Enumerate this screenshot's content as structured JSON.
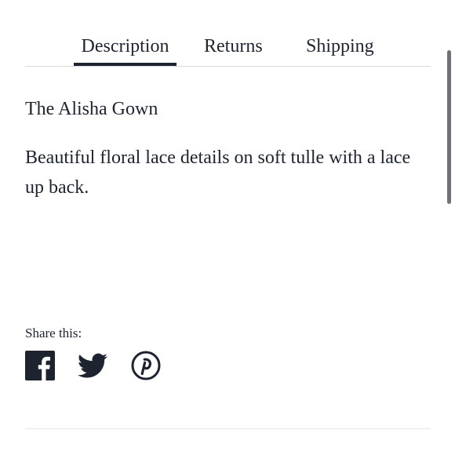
{
  "tabs": [
    {
      "label": "Description",
      "active": true
    },
    {
      "label": "Returns",
      "active": false
    },
    {
      "label": "Shipping",
      "active": false
    }
  ],
  "product": {
    "title": "The Alisha Gown",
    "description": "Beautiful floral lace details on soft tulle with a lace up back."
  },
  "share": {
    "label": "Share this:",
    "icons": [
      "facebook-icon",
      "twitter-icon",
      "pinterest-icon"
    ]
  },
  "colors": {
    "text": "#1d2430",
    "accent": "#1d2430",
    "divider": "#d9dbdf"
  }
}
